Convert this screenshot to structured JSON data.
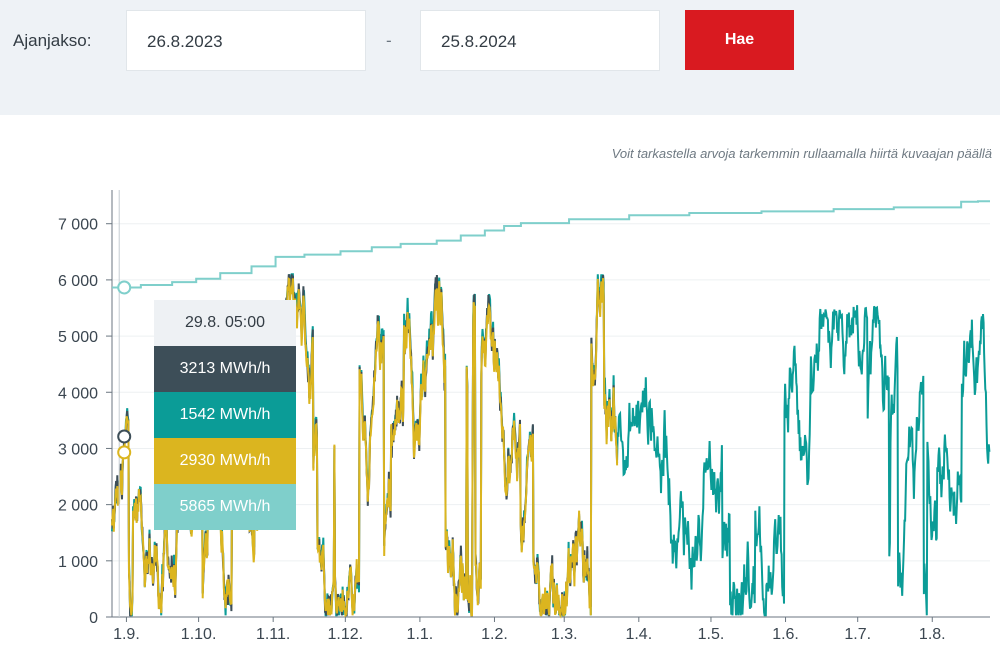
{
  "filter": {
    "period_label": "Ajanjakso:",
    "start_date": "26.8.2023",
    "separator": "-",
    "end_date": "25.8.2024",
    "search_label": "Hae"
  },
  "hint_text": "Voit tarkastella arvoja tarkemmin rullaamalla hiirtä kuvaajan päällä",
  "colors": {
    "dark": "#3d4e58",
    "teal": "#0b9c97",
    "yellow": "#dbb51f",
    "light_teal": "#7fcfcb",
    "accent_red": "#d91a20"
  },
  "tooltip": {
    "time": "29.8. 05:00",
    "values": [
      {
        "text": "3213 MWh/h",
        "color": "#3d4e58"
      },
      {
        "text": "1542 MWh/h",
        "color": "#0b9c97"
      },
      {
        "text": "2930 MWh/h",
        "color": "#dbb51f"
      },
      {
        "text": "5865 MWh/h",
        "color": "#7fcfcb"
      }
    ]
  },
  "chart_data": {
    "type": "line",
    "x_range": [
      "26.8.2023",
      "25.8.2024"
    ],
    "ylim": [
      0,
      7600
    ],
    "y_ticks": [
      0,
      1000,
      2000,
      3000,
      4000,
      5000,
      6000,
      7000
    ],
    "y_tick_labels": [
      "0",
      "1 000",
      "2 000",
      "3 000",
      "4 000",
      "5 000",
      "6 000",
      "7 000"
    ],
    "x_tick_labels": [
      "1.9.",
      "1.10.",
      "1.11.",
      "1.12.",
      "1.1.",
      "1.2.",
      "1.3.",
      "1.4.",
      "1.5.",
      "1.6.",
      "1.7.",
      "1.8."
    ],
    "x_tick_days": [
      6,
      36,
      67,
      97,
      128,
      159,
      188,
      219,
      249,
      280,
      310,
      341
    ],
    "total_days": 365,
    "series": [
      {
        "color": "#3d4e58",
        "end_day": 210
      },
      {
        "color": "#0b9c97",
        "end_day": 365
      },
      {
        "color": "#dbb51f",
        "end_day": 210
      },
      {
        "color": "#7fcfcb",
        "step_points": [
          [
            0,
            5865
          ],
          [
            12,
            5910
          ],
          [
            25,
            5960
          ],
          [
            35,
            6020
          ],
          [
            45,
            6120
          ],
          [
            58,
            6240
          ],
          [
            68,
            6410
          ],
          [
            80,
            6450
          ],
          [
            95,
            6510
          ],
          [
            108,
            6580
          ],
          [
            120,
            6640
          ],
          [
            135,
            6700
          ],
          [
            145,
            6790
          ],
          [
            155,
            6880
          ],
          [
            163,
            6960
          ],
          [
            170,
            7010
          ],
          [
            190,
            7080
          ],
          [
            215,
            7150
          ],
          [
            240,
            7190
          ],
          [
            270,
            7220
          ],
          [
            300,
            7260
          ],
          [
            325,
            7290
          ],
          [
            353,
            7390
          ],
          [
            360,
            7400
          ],
          [
            365,
            7400
          ]
        ]
      }
    ],
    "hover_day": 3
  }
}
